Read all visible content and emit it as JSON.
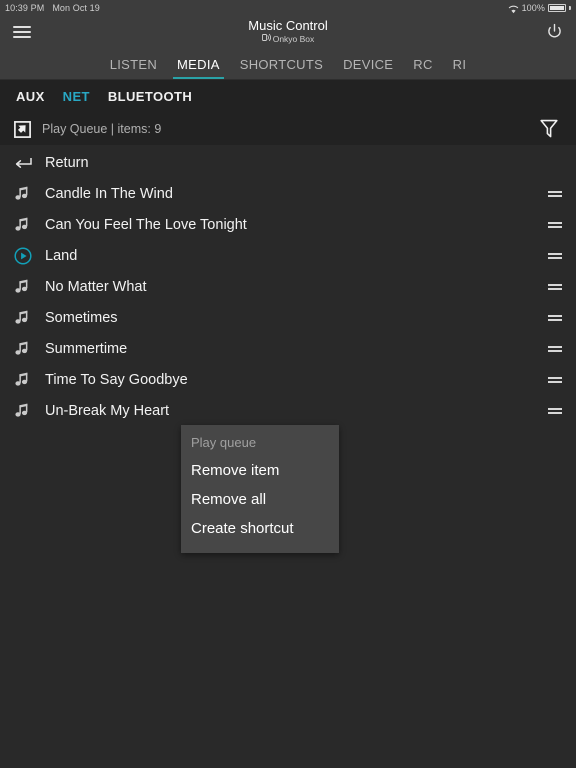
{
  "statusbar": {
    "time": "10:39 PM",
    "date": "Mon Oct 19",
    "battery_percent": "100%",
    "wifi_icon": "wifi-icon",
    "battery_icon": "battery-icon"
  },
  "appbar": {
    "menu_icon": "hamburger-menu-icon",
    "title": "Music Control",
    "subtitle": "Onkyo Box",
    "device_icon": "speaker-device-icon",
    "power_icon": "power-icon"
  },
  "tabs": [
    {
      "label": "LISTEN",
      "active": false
    },
    {
      "label": "MEDIA",
      "active": true
    },
    {
      "label": "SHORTCUTS",
      "active": false
    },
    {
      "label": "DEVICE",
      "active": false
    },
    {
      "label": "RC",
      "active": false
    },
    {
      "label": "RI",
      "active": false
    }
  ],
  "sources": [
    {
      "label": "AUX",
      "active": false
    },
    {
      "label": "NET",
      "active": true
    },
    {
      "label": "BLUETOOTH",
      "active": false
    }
  ],
  "breadcrumb": {
    "icon": "top-level-cursor-icon",
    "text": "Play Queue | items: 9",
    "filter_icon": "filter-funnel-icon"
  },
  "list": [
    {
      "icon": "return-arrow-icon",
      "label": "Return",
      "drag": false,
      "playing": false
    },
    {
      "icon": "music-note-icon",
      "label": "Candle In The Wind",
      "drag": true,
      "playing": false
    },
    {
      "icon": "music-note-icon",
      "label": "Can You Feel The Love Tonight",
      "drag": true,
      "playing": false
    },
    {
      "icon": "play-circle-icon",
      "label": "Land",
      "drag": true,
      "playing": true
    },
    {
      "icon": "music-note-icon",
      "label": "No Matter What",
      "drag": true,
      "playing": false
    },
    {
      "icon": "music-note-icon",
      "label": "Sometimes",
      "drag": true,
      "playing": false
    },
    {
      "icon": "music-note-icon",
      "label": "Summertime",
      "drag": true,
      "playing": false
    },
    {
      "icon": "music-note-icon",
      "label": "Time To Say Goodbye",
      "drag": true,
      "playing": false
    },
    {
      "icon": "music-note-icon",
      "label": "Un-Break My Heart",
      "drag": true,
      "playing": false
    }
  ],
  "context_menu": {
    "header": "Play queue",
    "items": [
      "Remove item",
      "Remove all",
      "Create shortcut"
    ]
  },
  "colors": {
    "accent": "#29a8c4",
    "tab_underline": "#2aa3a8",
    "bar_bg": "#3d3d3d",
    "list_bg": "#292929",
    "page_bg": "#222222",
    "menu_bg": "#474747"
  }
}
